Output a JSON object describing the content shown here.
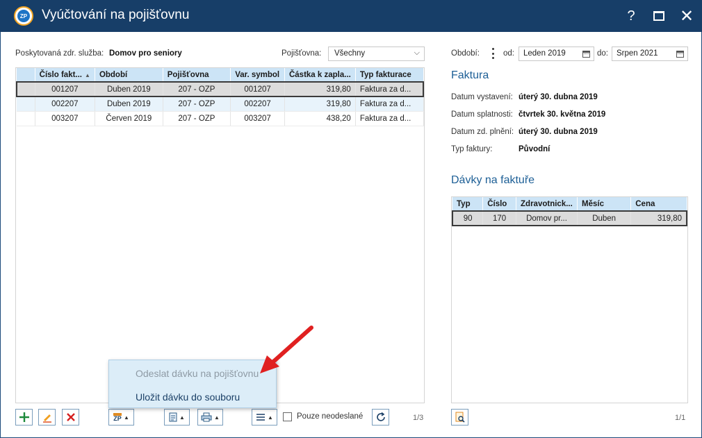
{
  "window": {
    "title": "Vyúčtování na pojišťovnu",
    "logo_text": "ZP",
    "help_label": "?"
  },
  "filters": {
    "service_label": "Poskytovaná zdr. služba:",
    "service_value": "Domov pro seniory",
    "insurer_label": "Pojišťovna:",
    "insurer_value": "Všechny",
    "period_label": "Období:",
    "from_label": "od:",
    "from_value": "Leden 2019",
    "to_label": "do:",
    "to_value": "Srpen 2021"
  },
  "invoices": {
    "columns": [
      "Číslo fakt...",
      "Období",
      "Pojišťovna",
      "Var. symbol",
      "Částka k zapla...",
      "Typ fakturace"
    ],
    "rows": [
      [
        "001207",
        "Duben 2019",
        "207 - OZP",
        "001207",
        "319,80",
        "Faktura za d..."
      ],
      [
        "002207",
        "Duben 2019",
        "207 - OZP",
        "002207",
        "319,80",
        "Faktura za d..."
      ],
      [
        "003207",
        "Červen 2019",
        "207 - OZP",
        "003207",
        "438,20",
        "Faktura za d..."
      ]
    ],
    "pager": "1/3"
  },
  "invoice_detail": {
    "title": "Faktura",
    "issued_label": "Datum vystavení:",
    "issued_value": "úterý 30. dubna 2019",
    "due_label": "Datum splatnosti:",
    "due_value": "čtvrtek 30. května 2019",
    "supply_label": "Datum zd. plnění:",
    "supply_value": "úterý 30. dubna 2019",
    "type_label": "Typ faktury:",
    "type_value": "Původní"
  },
  "batches": {
    "title": "Dávky na faktuře",
    "columns": [
      "Typ",
      "Číslo",
      "Zdravotnick...",
      "Měsíc",
      "Cena"
    ],
    "rows": [
      [
        "90",
        "170",
        "Domov pr...",
        "Duben",
        "319,80"
      ]
    ],
    "pager": "1/1"
  },
  "toolbar": {
    "zp_label": "ZP",
    "only_unsent_label": "Pouze neodeslané"
  },
  "popup_menu": {
    "send_label": "Odeslat dávku na pojišťovnu",
    "save_label": "Uložit dávku do souboru"
  },
  "colors": {
    "titlebar": "#173e68",
    "header_row": "#cce4f6",
    "accent": "#1d5f96",
    "annotation_arrow": "#e02020"
  }
}
